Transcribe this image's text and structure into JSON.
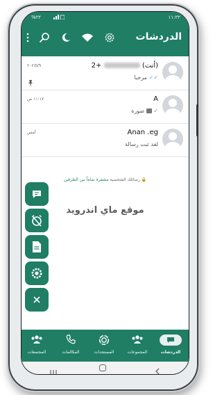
{
  "status": {
    "time": "١١:٢٢",
    "battery": "%٢٢"
  },
  "appbar": {
    "title": "الدردشات"
  },
  "chats": [
    {
      "name": "(أنت)",
      "name_prefix": "+2",
      "message": "مرحبا",
      "time": "٢٠٢/٥/٩"
    },
    {
      "name": "A",
      "message": "صورة",
      "time": "١١:١٧ ص"
    },
    {
      "name": "Anan .eg",
      "message": "لقد ثبت رسالة",
      "time": "أمس"
    }
  ],
  "encryption": {
    "text_before": "رسائلك الشخصية ",
    "highlight": "مشفرة تماماً بين الطرفين"
  },
  "watermark": "موقع ماي اندرويد",
  "bottom_nav": [
    {
      "label": "الدردشات"
    },
    {
      "label": "المجموعات"
    },
    {
      "label": "المستجدات"
    },
    {
      "label": "المكالمات"
    },
    {
      "label": "المجتمعات"
    }
  ],
  "colors": {
    "primary": "#1f7e64"
  }
}
